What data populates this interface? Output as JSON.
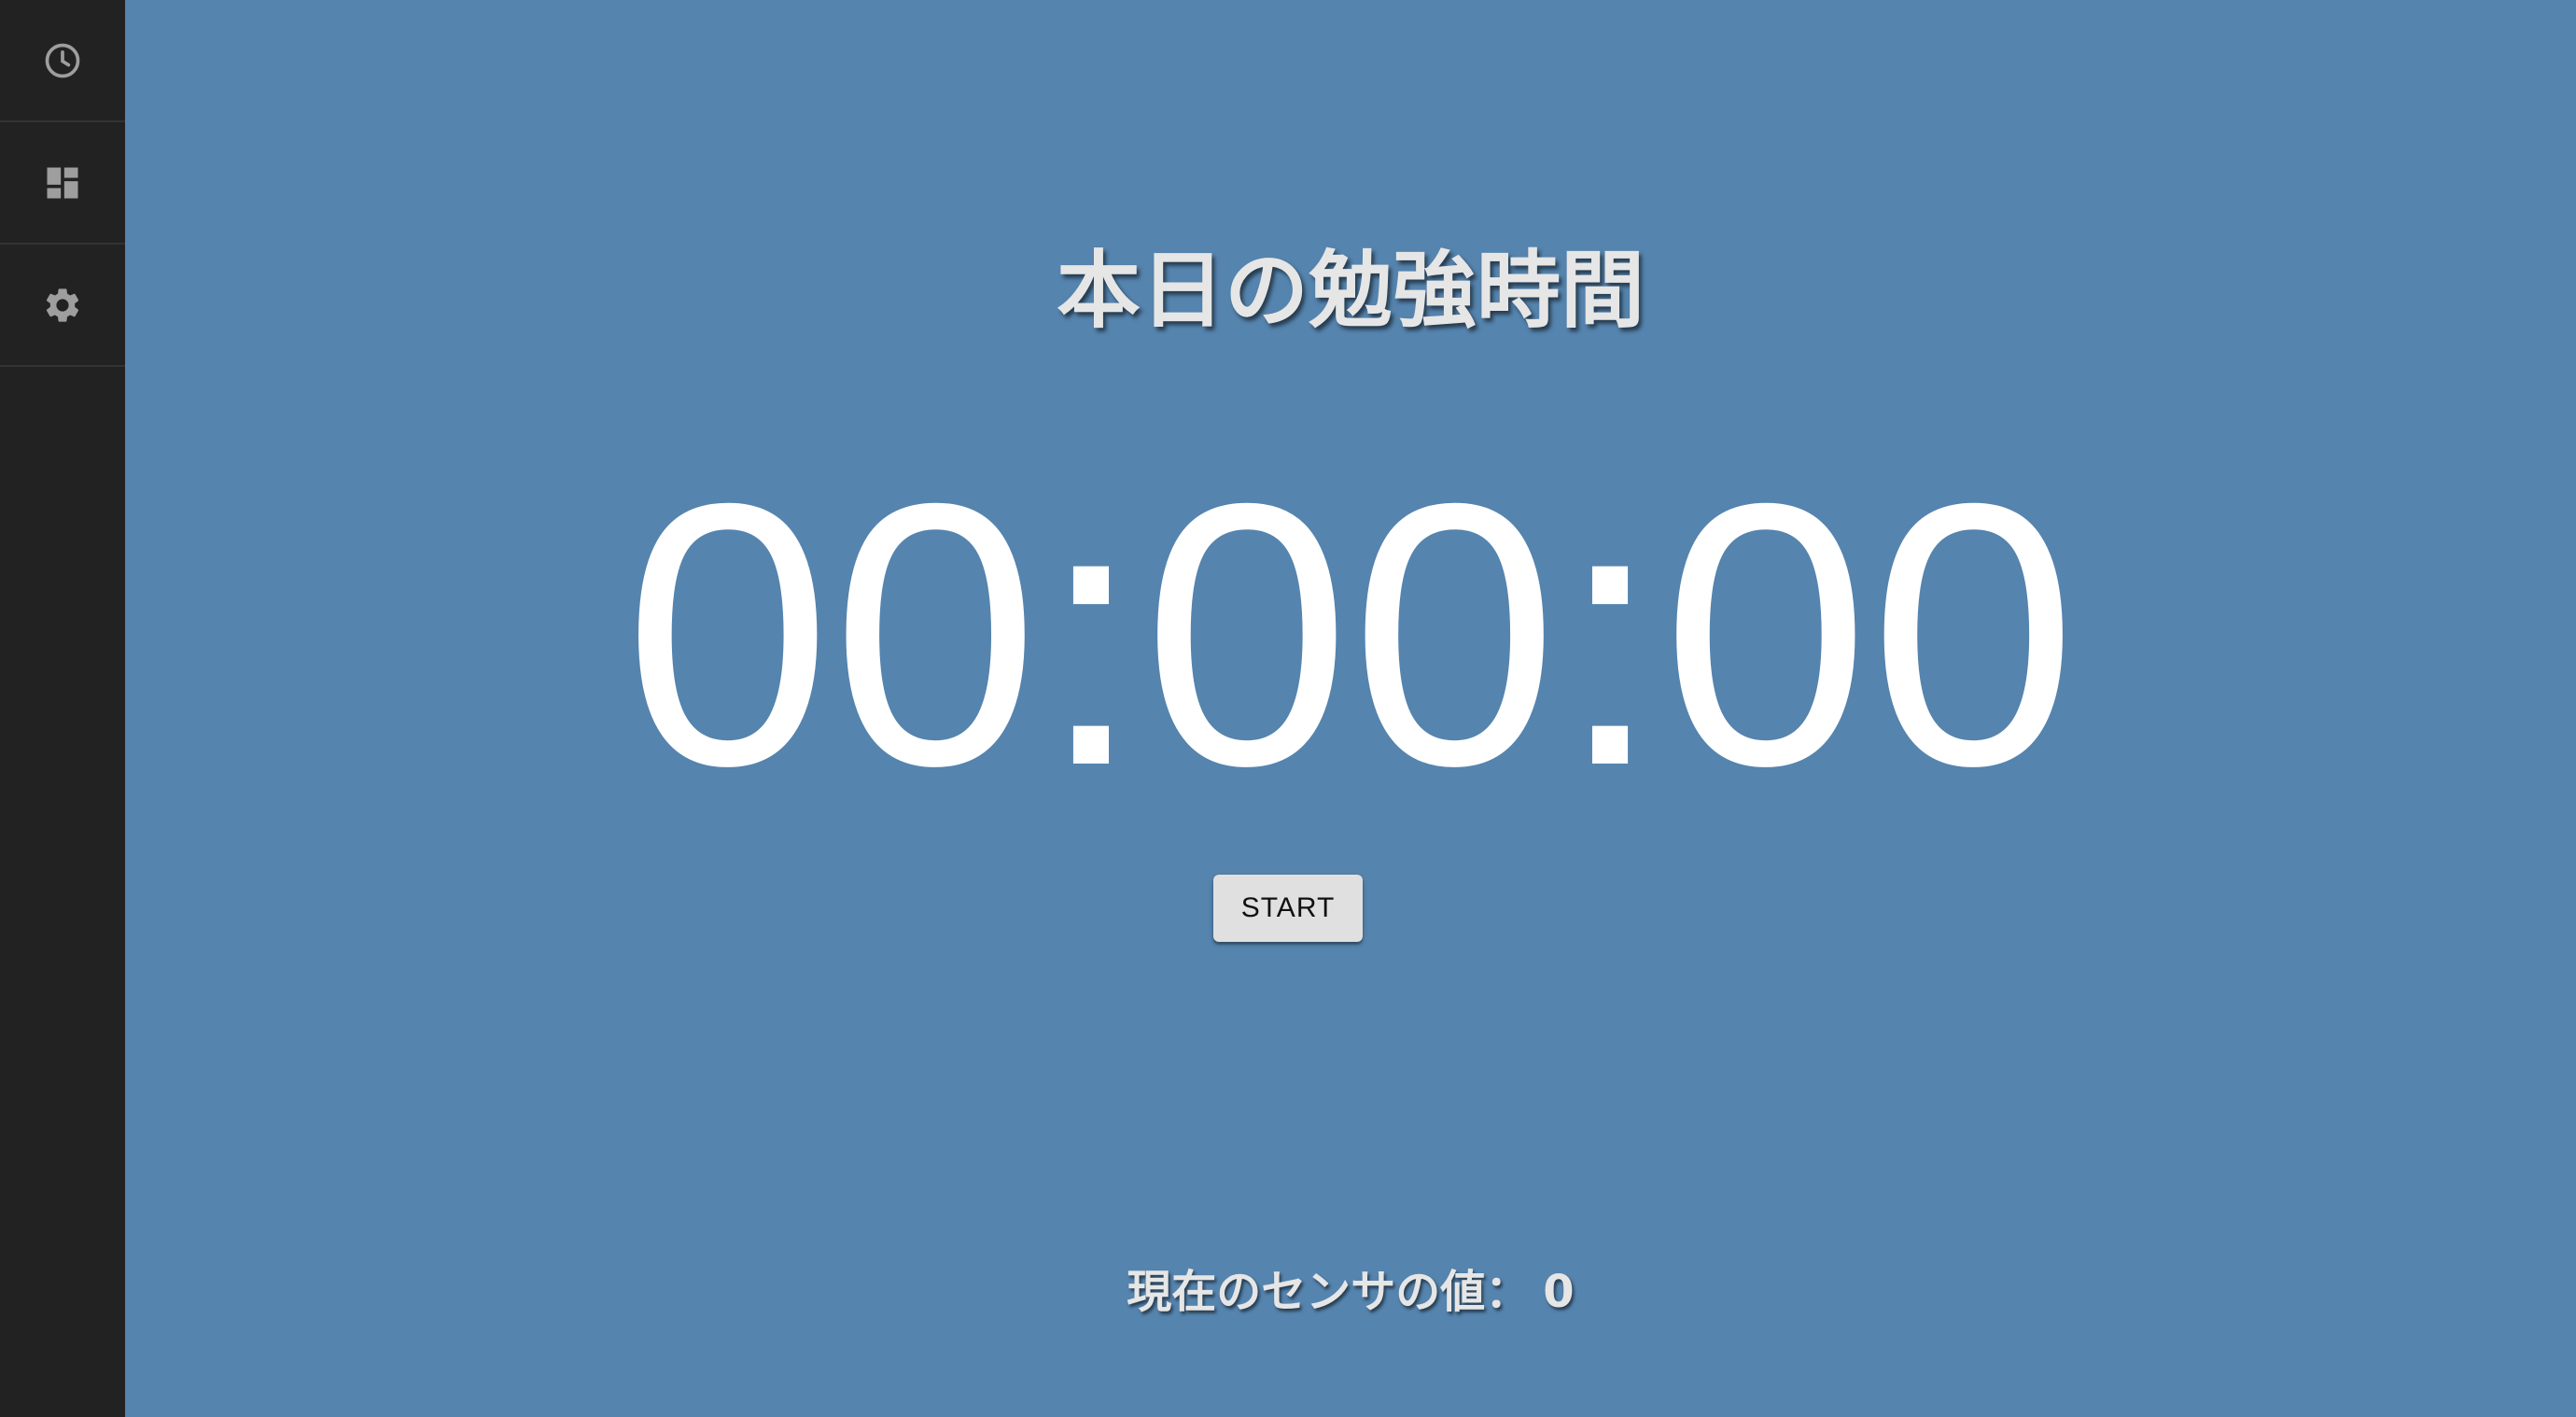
{
  "sidebar": {
    "items": [
      {
        "icon": "clock-icon"
      },
      {
        "icon": "dashboard-icon"
      },
      {
        "icon": "gear-icon"
      }
    ]
  },
  "main": {
    "title": "本日の勉強時間",
    "timer": "00:00:00",
    "start_label": "START",
    "sensor_label": "現在のセンサの値：",
    "sensor_value": "0"
  },
  "colors": {
    "background": "#5584ae",
    "sidebar": "#222222",
    "icon": "#9e9e9e",
    "timer_text": "#ffffff",
    "button": "#e0e0e0"
  }
}
